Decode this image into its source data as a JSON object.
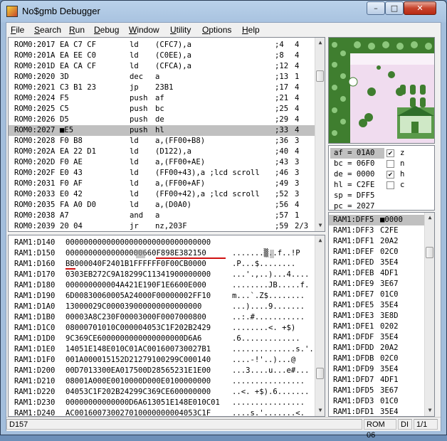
{
  "window": {
    "title": "No$gmb Debugger",
    "min": "–",
    "max": "□",
    "close": "✕"
  },
  "menu": [
    {
      "label": "File",
      "key": "F",
      "rest": "ile"
    },
    {
      "label": "Search",
      "key": "S",
      "rest": "earch"
    },
    {
      "label": "Run",
      "key": "R",
      "rest": "un"
    },
    {
      "label": "Debug",
      "key": "D",
      "rest": "ebug"
    },
    {
      "label": "Window",
      "key": "W",
      "rest": "indow"
    },
    {
      "label": "Utility",
      "key": "U",
      "rest": "tility"
    },
    {
      "label": "Options",
      "key": "O",
      "rest": "ptions"
    },
    {
      "label": "Help",
      "key": "H",
      "rest": "elp"
    }
  ],
  "disasm": [
    {
      "addr": "ROM0:2017",
      "bytes": "EA C7 CF",
      "mn": "ld",
      "ops": "(CFC7),a",
      "cyc": ";4",
      "cnt": "4"
    },
    {
      "addr": "ROM0:201A",
      "bytes": "EA EE C0",
      "mn": "ld",
      "ops": "(C0EE),a",
      "cyc": ";8",
      "cnt": "4"
    },
    {
      "addr": "ROM0:201D",
      "bytes": "EA CA CF",
      "mn": "ld",
      "ops": "(CFCA),a",
      "cyc": ";12",
      "cnt": "4"
    },
    {
      "addr": "ROM0:2020",
      "bytes": "3D",
      "mn": "dec",
      "ops": "a",
      "cyc": ";13",
      "cnt": "1"
    },
    {
      "addr": "ROM0:2021",
      "bytes": "C3 B1 23",
      "mn": "jp",
      "ops": "23B1",
      "cyc": ";17",
      "cnt": "4"
    },
    {
      "addr": "ROM0:2024",
      "bytes": "F5",
      "mn": "push",
      "ops": "af",
      "cyc": ";21",
      "cnt": "4"
    },
    {
      "addr": "ROM0:2025",
      "bytes": "C5",
      "mn": "push",
      "ops": "bc",
      "cyc": ";25",
      "cnt": "4"
    },
    {
      "addr": "ROM0:2026",
      "bytes": "D5",
      "mn": "push",
      "ops": "de",
      "cyc": ";29",
      "cnt": "4"
    },
    {
      "addr": "ROM0:2027",
      "bytes": "■E5",
      "mn": "push",
      "ops": "hl",
      "cyc": ";33",
      "cnt": "4",
      "current": true
    },
    {
      "addr": "ROM0:2028",
      "bytes": "F0 B8",
      "mn": "ld",
      "ops": "a,(FF00+B8)",
      "cyc": ";36",
      "cnt": "3"
    },
    {
      "addr": "ROM0:202A",
      "bytes": "EA 22 D1",
      "mn": "ld",
      "ops": "(D122),a",
      "cyc": ";40",
      "cnt": "4"
    },
    {
      "addr": "ROM0:202D",
      "bytes": "F0 AE",
      "mn": "ld",
      "ops": "a,(FF00+AE)",
      "cyc": ";43",
      "cnt": "3"
    },
    {
      "addr": "ROM0:202F",
      "bytes": "E0 43",
      "mn": "ld",
      "ops": "(FF00+43),a ;lcd scroll",
      "cyc": ";46",
      "cnt": "3"
    },
    {
      "addr": "ROM0:2031",
      "bytes": "F0 AF",
      "mn": "ld",
      "ops": "a,(FF00+AF)",
      "cyc": ";49",
      "cnt": "3"
    },
    {
      "addr": "ROM0:2033",
      "bytes": "E0 42",
      "mn": "ld",
      "ops": "(FF00+42),a ;lcd scroll",
      "cyc": ";52",
      "cnt": "3"
    },
    {
      "addr": "ROM0:2035",
      "bytes": "FA A0 D0",
      "mn": "ld",
      "ops": "a,(D0A0)",
      "cyc": ";56",
      "cnt": "4"
    },
    {
      "addr": "ROM0:2038",
      "bytes": "A7",
      "mn": "and",
      "ops": "a",
      "cyc": ";57",
      "cnt": "1"
    },
    {
      "addr": "ROM0:2039",
      "bytes": "20 04",
      "mn": "jr",
      "ops": "nz,203F",
      "cyc": ";59",
      "cnt": "2/3"
    }
  ],
  "registers": [
    {
      "label": "af = 01A0",
      "flag": "z",
      "checked": true
    },
    {
      "label": "bc = 06F0",
      "flag": "n",
      "checked": false
    },
    {
      "label": "de = 0000",
      "flag": "h",
      "checked": true
    },
    {
      "label": "hl = C2FE",
      "flag": "c",
      "checked": false
    },
    {
      "label": "sp = DFF5"
    },
    {
      "label": "pc = 2027"
    }
  ],
  "memdump": [
    {
      "addr": "RAM1:D140",
      "hex": "00000000000000000000000000000000",
      "ascii": ""
    },
    {
      "addr": "RAM1:D150",
      "hex": "00000000000000000660F898E382150",
      "ascii": ".......▒..f..!P"
    },
    {
      "addr": "RAM1:D160",
      "hex": "BB000040F2401B1FFFFFF0F00CB0000",
      "ascii": ".P...$........"
    },
    {
      "addr": "RAM1:D170",
      "hex": "0303EB272C9A18299C11341900000000",
      "ascii": "...'.,..)...4...."
    },
    {
      "addr": "RAM1:D180",
      "hex": "000000000004A421E190F1E6600E000",
      "ascii": "........JB.....f."
    },
    {
      "addr": "RAM1:D190",
      "hex": "6D00830060005A24000F00000002FF10",
      "ascii": "m...`.Z$........"
    },
    {
      "addr": "RAM1:D1A0",
      "hex": "13000029C000039000000000000000",
      "ascii": "...)....9......."
    },
    {
      "addr": "RAM1:D1B0",
      "hex": "00003A8C230F00003000F0007000800",
      "ascii": "..:.#..........."
    },
    {
      "addr": "RAM1:D1C0",
      "hex": "08000701010C000004053C1F202B2429",
      "ascii": "........<. +$)"
    },
    {
      "addr": "RAM1:D1D0",
      "hex": "9C369CE6000000000000000000D6A6",
      "ascii": ".6............."
    },
    {
      "addr": "RAM1:D1E0",
      "hex": "14051E148E010C01AC001600730027B1",
      "ascii": "..............s.'."
    },
    {
      "addr": "RAM1:D1F0",
      "hex": "001A000015152D21279100299C000140",
      "ascii": "....-!'..)...@"
    },
    {
      "addr": "RAM1:D200",
      "hex": "00D7013300EA017500D28565231E1E00",
      "ascii": "...3....u...e#..."
    },
    {
      "addr": "RAM1:D210",
      "hex": "08001A000E0010000D000E0100000000",
      "ascii": "................"
    },
    {
      "addr": "RAM1:D220",
      "hex": "04053C1F202B24299C369CE600000000",
      "ascii": "..<. +$).6......."
    },
    {
      "addr": "RAM1:D230",
      "hex": "00000000000000D6A613051E148E010C01",
      "ascii": "................"
    },
    {
      "addr": "RAM1:D240",
      "hex": "AC001600730027010000000004053C1F",
      "ascii": "....s.'.......<."
    }
  ],
  "stack": [
    {
      "addr": "RAM1:DFF5",
      "val": "■0000",
      "current": true
    },
    {
      "addr": "RAM1:DFF3",
      "val": "C2FE"
    },
    {
      "addr": "RAM1:DFF1",
      "val": "20A2"
    },
    {
      "addr": "RAM1:DFEF",
      "val": "02C0"
    },
    {
      "addr": "RAM1:DFED",
      "val": "35E4"
    },
    {
      "addr": "RAM1:DFEB",
      "val": "4DF1"
    },
    {
      "addr": "RAM1:DFE9",
      "val": "3E67"
    },
    {
      "addr": "RAM1:DFE7",
      "val": "01C0"
    },
    {
      "addr": "RAM1:DFE5",
      "val": "35E4"
    },
    {
      "addr": "RAM1:DFE3",
      "val": "3E8D"
    },
    {
      "addr": "RAM1:DFE1",
      "val": "0202"
    },
    {
      "addr": "RAM1:DFDF",
      "val": "35E4"
    },
    {
      "addr": "RAM1:DFDD",
      "val": "20A2"
    },
    {
      "addr": "RAM1:DFDB",
      "val": "02C0"
    },
    {
      "addr": "RAM1:DFD9",
      "val": "35E4"
    },
    {
      "addr": "RAM1:DFD7",
      "val": "4DF1"
    },
    {
      "addr": "RAM1:DFD5",
      "val": "3E67"
    },
    {
      "addr": "RAM1:DFD3",
      "val": "01C0"
    },
    {
      "addr": "RAM1:DFD1",
      "val": "35E4"
    }
  ],
  "status": {
    "left": "D157",
    "rom": "ROM 06",
    "di": "DI",
    "page": "1/1"
  },
  "colors": {
    "highlight": "#c0c0c0",
    "underline": "#d01010",
    "lcd_bg": "#f0dcef",
    "lcd_grass": "#3f7e2f"
  }
}
